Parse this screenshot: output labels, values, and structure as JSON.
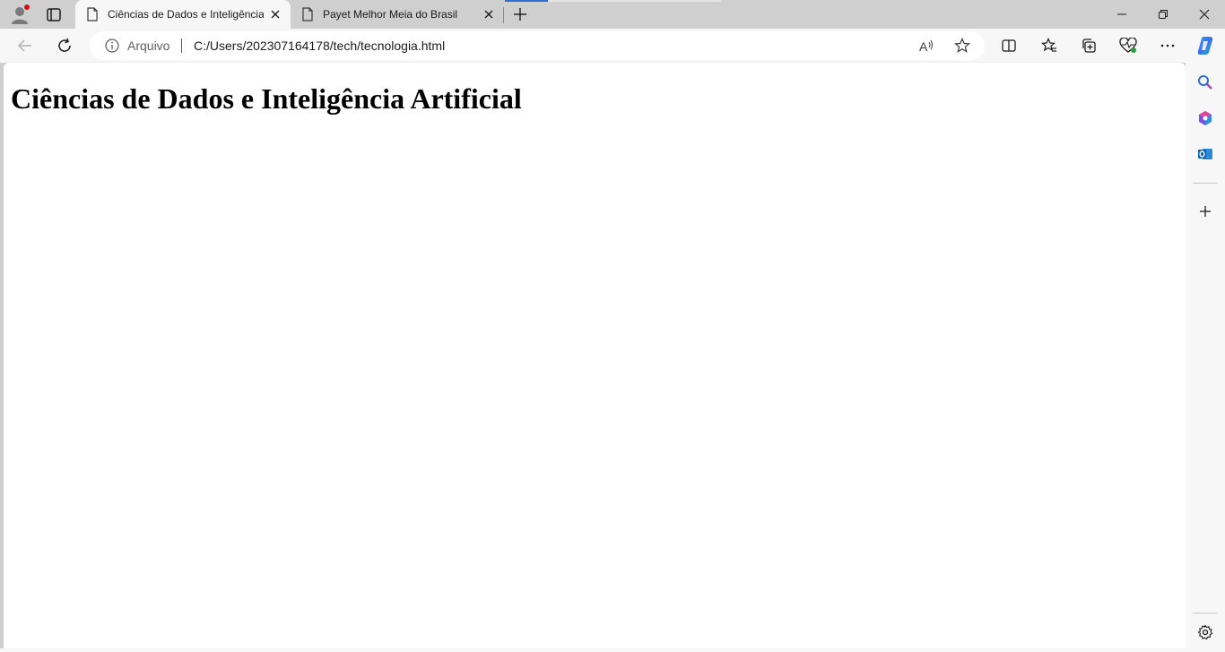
{
  "tabs": [
    {
      "label": "Ciências de Dados e Inteligência Artificial",
      "active": true
    },
    {
      "label": "Payet Melhor Meia do Brasil",
      "active": false
    }
  ],
  "address": {
    "scheme_label": "Arquivo",
    "url": "C:/Users/202307164178/tech/tecnologia.html"
  },
  "page": {
    "heading": "Ciências de Dados e Inteligência Artificial"
  },
  "icons": {
    "profile": "profile-icon",
    "tab_actions": "tab-actions-icon",
    "back": "back-arrow-icon",
    "refresh": "refresh-icon",
    "read_aloud": "read-aloud-icon",
    "favorite": "star-icon",
    "split": "split-screen-icon",
    "favorites": "favorites-icon",
    "collections": "collections-icon",
    "browser_essentials": "heart-pulse-icon",
    "more": "more-icon",
    "copilot": "copilot-icon"
  },
  "colors": {
    "accent": "#2f6fd0",
    "chrome_bg": "#cfcfcf",
    "toolbar_bg": "#f7f7f7"
  }
}
